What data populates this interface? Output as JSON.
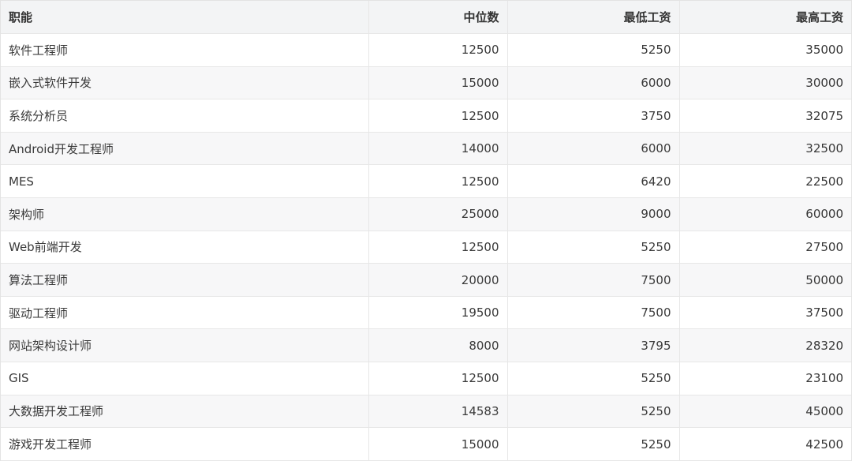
{
  "table": {
    "headers": [
      "职能",
      "中位数",
      "最低工资",
      "最高工资"
    ],
    "rows": [
      [
        "软件工程师",
        "12500",
        "5250",
        "35000"
      ],
      [
        "嵌入式软件开发",
        "15000",
        "6000",
        "30000"
      ],
      [
        "系统分析员",
        "12500",
        "3750",
        "32075"
      ],
      [
        "Android开发工程师",
        "14000",
        "6000",
        "32500"
      ],
      [
        "MES",
        "12500",
        "6420",
        "22500"
      ],
      [
        "架构师",
        "25000",
        "9000",
        "60000"
      ],
      [
        "Web前端开发",
        "12500",
        "5250",
        "27500"
      ],
      [
        "算法工程师",
        "20000",
        "7500",
        "50000"
      ],
      [
        "驱动工程师",
        "19500",
        "7500",
        "37500"
      ],
      [
        "网站架构设计师",
        "8000",
        "3795",
        "28320"
      ],
      [
        "GIS",
        "12500",
        "5250",
        "23100"
      ],
      [
        "大数据开发工程师",
        "14583",
        "5250",
        "45000"
      ],
      [
        "游戏开发工程师",
        "15000",
        "5250",
        "42500"
      ]
    ]
  }
}
